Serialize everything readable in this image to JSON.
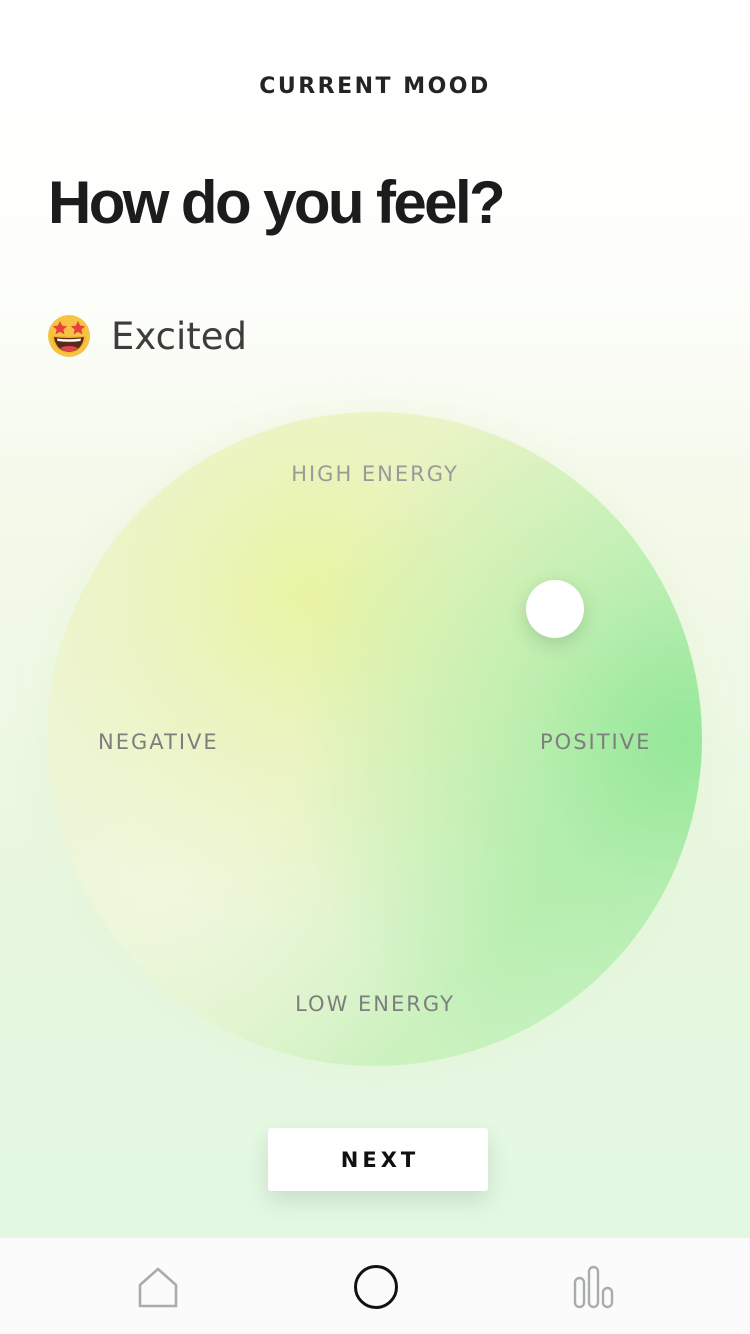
{
  "header": {
    "title": "CURRENT MOOD"
  },
  "question": "How do you feel?",
  "mood": {
    "emoji_icon": "star-struck-emoji-icon",
    "label": "Excited"
  },
  "wheel": {
    "labels": {
      "top": "HIGH ENERGY",
      "bottom": "LOW ENERGY",
      "left": "NEGATIVE",
      "right": "POSITIVE"
    },
    "colors": {
      "positive": "#8fe89a",
      "high_energy": "#e8f3a0",
      "neutral": "#f2f6e0"
    }
  },
  "next_button": {
    "label": "NEXT"
  },
  "tab_bar": {
    "items": [
      {
        "icon": "home-icon",
        "active": false
      },
      {
        "icon": "circle-icon",
        "active": true
      },
      {
        "icon": "bar-chart-icon",
        "active": false
      }
    ],
    "colors": {
      "active": "#111111",
      "inactive": "#a9acaf"
    }
  }
}
